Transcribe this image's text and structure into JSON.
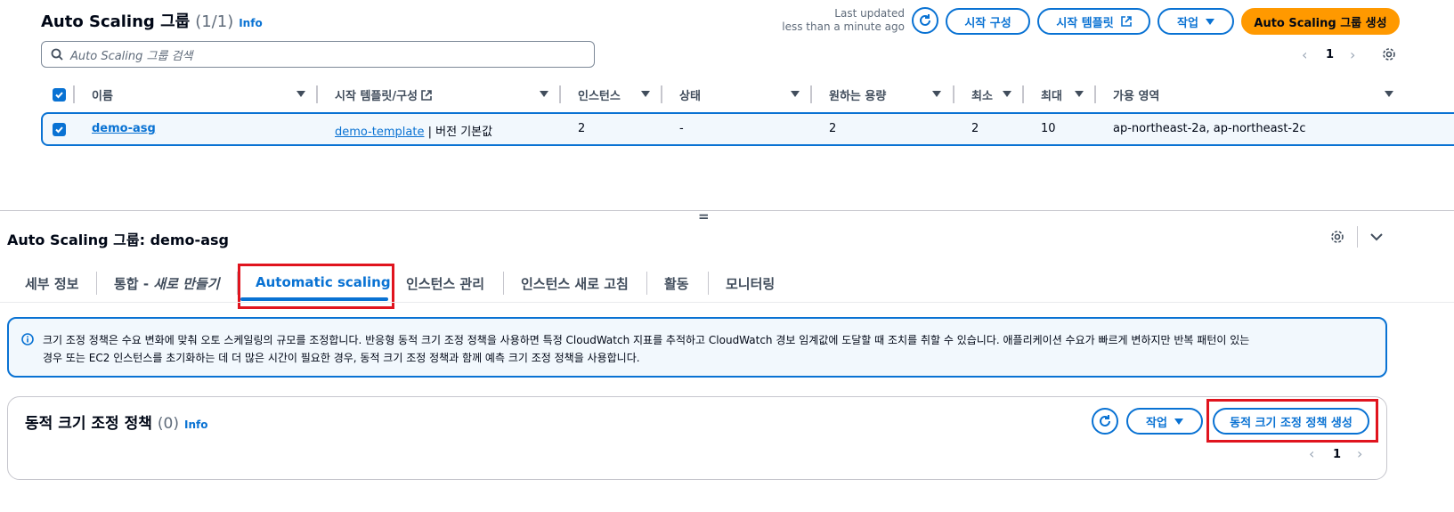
{
  "top": {
    "title": "Auto Scaling 그룹",
    "count": "(1/1)",
    "info": "Info",
    "last_updated_label": "Last updated",
    "last_updated_value": "less than a minute ago",
    "buttons": {
      "launch_config": "시작 구성",
      "launch_template": "시작 템플릿",
      "actions": "작업",
      "create": "Auto Scaling 그룹 생성"
    },
    "search_placeholder": "Auto Scaling 그룹 검색",
    "page": "1"
  },
  "table": {
    "columns": [
      "이름",
      "시작 템플릿/구성",
      "인스턴스",
      "상태",
      "원하는 용량",
      "최소",
      "최대",
      "가용 영역"
    ],
    "row": {
      "name": "demo-asg",
      "template_link": "demo-template",
      "template_suffix": "| 버전 기본값",
      "instances": "2",
      "status": "-",
      "desired": "2",
      "min": "2",
      "max": "10",
      "az": "ap-northeast-2a, ap-northeast-2c"
    }
  },
  "detail": {
    "title": "Auto Scaling 그룹: demo-asg",
    "divider_glyph": "=",
    "tabs": [
      "세부 정보",
      "통합 - 새로 만들기",
      "Automatic scaling",
      "인스턴스 관리",
      "인스턴스 새로 고침",
      "활동",
      "모니터링"
    ],
    "tab_integration_main": "통합 - ",
    "tab_integration_em": "새로 만들기",
    "alert_line1": "크기 조정 정책은 수요 변화에 맞춰 오토 스케일링의 규모를 조정합니다. 반응형 동적 크기 조정 정책을 사용하면 특정 CloudWatch 지표를 추적하고 CloudWatch 경보 임계값에 도달할 때 조치를 취할 수 있습니다. 애플리케이션 수요가 빠르게 변하지만 반복 패턴이 있는",
    "alert_line2": "경우 또는 EC2 인스턴스를 초기화하는 데 더 많은 시간이 필요한 경우, 동적 크기 조정 정책과 함께 예측 크기 조정 정책을 사용합니다.",
    "policies": {
      "title": "동적 크기 조정 정책",
      "count": "(0)",
      "info": "Info",
      "actions": "작업",
      "create": "동적 크기 조정 정책 생성",
      "page": "1"
    }
  },
  "colors": {
    "accent": "#0972d3",
    "primary": "#ff9900",
    "highlight": "#e0141e",
    "selected_row_bg": "#f2f8fd"
  }
}
